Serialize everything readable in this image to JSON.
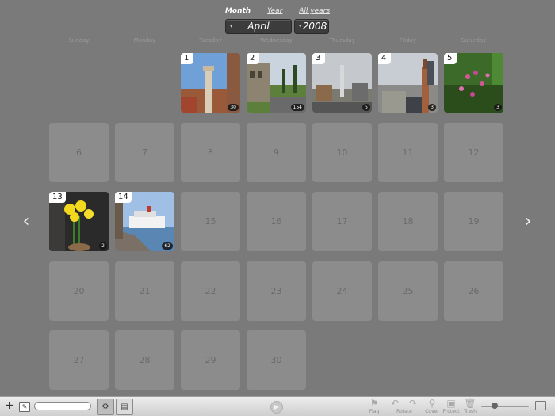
{
  "view_tabs": [
    "Month",
    "Year",
    "All years"
  ],
  "active_view": "Month",
  "month_picker": {
    "value": "April",
    "arrow": "▾"
  },
  "year_picker": {
    "value": "2008",
    "arrow": "▾"
  },
  "weekdays": [
    "Sunday",
    "Monday",
    "Tuesday",
    "Wednesday",
    "Thursday",
    "Friday",
    "Saturday"
  ],
  "days_in_month": 30,
  "first_weekday_index": 2,
  "photo_days": {
    "1": {
      "count": "30",
      "scene": "tower"
    },
    "2": {
      "count": "154",
      "scene": "ruins"
    },
    "3": {
      "count": "5",
      "scene": "city-gray"
    },
    "4": {
      "count": "3",
      "scene": "church"
    },
    "5": {
      "count": "3",
      "scene": "flowers"
    },
    "13": {
      "count": "2",
      "scene": "daffodils"
    },
    "14": {
      "count": "62",
      "scene": "ship"
    }
  },
  "nav": {
    "prev": "‹",
    "next": "›"
  },
  "toolbar": {
    "add": "+",
    "edit": "✎",
    "search_value": "",
    "seg_a": "⚙",
    "seg_b": "▤",
    "play": "▶",
    "tools": [
      {
        "label": "Flag",
        "icon": "⚑"
      },
      {
        "label": "Rotate",
        "icon": "↶"
      },
      {
        "label": "Rotate",
        "icon": "↷"
      },
      {
        "label": "Cover",
        "icon": "⚲"
      },
      {
        "label": "Protect",
        "icon": "▣"
      },
      {
        "label": "Trash",
        "icon": "🗑"
      }
    ]
  }
}
